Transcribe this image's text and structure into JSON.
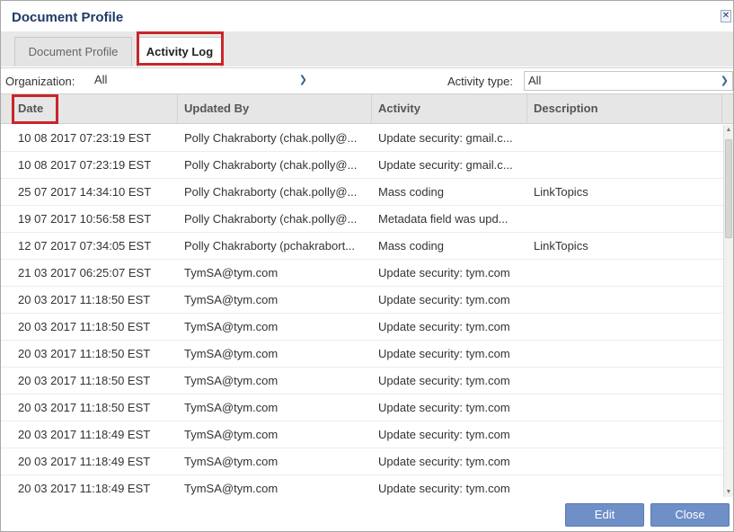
{
  "dialog": {
    "title": "Document Profile"
  },
  "tabs": [
    {
      "label": "Document Profile"
    },
    {
      "label": "Activity Log"
    }
  ],
  "filters": {
    "organization_label": "Organization:",
    "organization_value": "All",
    "activity_type_label": "Activity type:",
    "activity_type_value": "All"
  },
  "columns": [
    "Date",
    "Updated By",
    "Activity",
    "Description"
  ],
  "rows": [
    {
      "date": "10 08 2017 07:23:19 EST",
      "updated_by": "Polly Chakraborty (chak.polly@...",
      "activity": "Update security: gmail.c...",
      "description": ""
    },
    {
      "date": "10 08 2017 07:23:19 EST",
      "updated_by": "Polly Chakraborty (chak.polly@...",
      "activity": "Update security: gmail.c...",
      "description": ""
    },
    {
      "date": "25 07 2017 14:34:10 EST",
      "updated_by": "Polly Chakraborty (chak.polly@...",
      "activity": "Mass coding",
      "description": "LinkTopics"
    },
    {
      "date": "19 07 2017 10:56:58 EST",
      "updated_by": "Polly Chakraborty (chak.polly@...",
      "activity": "Metadata field was upd...",
      "description": ""
    },
    {
      "date": "12 07 2017 07:34:05 EST",
      "updated_by": "Polly Chakraborty (pchakrabort...",
      "activity": "Mass coding",
      "description": "LinkTopics"
    },
    {
      "date": "21 03 2017 06:25:07 EST",
      "updated_by": "TymSA@tym.com",
      "activity": "Update security: tym.com",
      "description": ""
    },
    {
      "date": "20 03 2017 11:18:50 EST",
      "updated_by": "TymSA@tym.com",
      "activity": "Update security: tym.com",
      "description": ""
    },
    {
      "date": "20 03 2017 11:18:50 EST",
      "updated_by": "TymSA@tym.com",
      "activity": "Update security: tym.com",
      "description": ""
    },
    {
      "date": "20 03 2017 11:18:50 EST",
      "updated_by": "TymSA@tym.com",
      "activity": "Update security: tym.com",
      "description": ""
    },
    {
      "date": "20 03 2017 11:18:50 EST",
      "updated_by": "TymSA@tym.com",
      "activity": "Update security: tym.com",
      "description": ""
    },
    {
      "date": "20 03 2017 11:18:50 EST",
      "updated_by": "TymSA@tym.com",
      "activity": "Update security: tym.com",
      "description": ""
    },
    {
      "date": "20 03 2017 11:18:49 EST",
      "updated_by": "TymSA@tym.com",
      "activity": "Update security: tym.com",
      "description": ""
    },
    {
      "date": "20 03 2017 11:18:49 EST",
      "updated_by": "TymSA@tym.com",
      "activity": "Update security: tym.com",
      "description": ""
    },
    {
      "date": "20 03 2017 11:18:49 EST",
      "updated_by": "TymSA@tym.com",
      "activity": "Update security: tym.com",
      "description": ""
    }
  ],
  "buttons": {
    "edit": "Edit",
    "close": "Close"
  },
  "icons": {
    "close": "close-icon",
    "dropdown": "chevron-down-icon"
  },
  "colors": {
    "title": "#1f3a66",
    "button": "#6f8fc7",
    "highlight": "#c8262a"
  }
}
